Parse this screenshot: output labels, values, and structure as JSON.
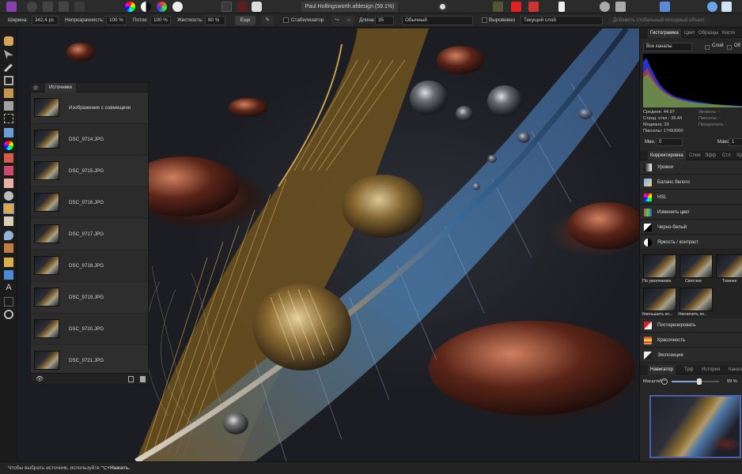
{
  "window": {
    "doc_title": "Paul Hollingsworth.afdesign (59.1%)"
  },
  "context_toolbar": {
    "width_label": "Ширина:",
    "width_value": "342,4 px",
    "opacity_label": "Непрозрачность:",
    "opacity_value": "100 %",
    "flow_label": "Поток:",
    "flow_value": "100 %",
    "hardness_label": "Жесткость:",
    "hardness_value": "80 %",
    "more_button": "Еще",
    "stabilizer_label": "Стабилизатор",
    "length_label": "Длина:",
    "length_value": "35",
    "mode_value": "Обычный",
    "aligned_label": "Выровнено",
    "source_value": "Текущий слой",
    "add_global_source": "Добавить глобальный исходный объект"
  },
  "sources_panel": {
    "tab": "Источники",
    "items": [
      "Изображение с совмещени",
      "DSC_9714.JPG",
      "DSC_9715.JPG",
      "DSC_9716.JPG",
      "DSC_9717.JPG",
      "DSC_9718.JPG",
      "DSC_9719.JPG",
      "DSC_9720.JPG",
      "DSC_9721.JPG"
    ]
  },
  "histogram_panel": {
    "tabs": [
      "Гистограмма",
      "Цвет",
      "Образцы",
      "Кисти"
    ],
    "channel_select": "Все каналы",
    "layer_label": "Слой",
    "ob_label": "Об",
    "stats_left": [
      "Среднее: 44.97",
      "Станд. откл.: 39.44",
      "Медиана: 33",
      "Пикселы: 17493000"
    ],
    "stats_right": [
      "Уровень: -",
      "Пикселы: -",
      "Процентиль: -"
    ],
    "min_label": "Мин.",
    "min_value": "0",
    "max_label": "Макс.",
    "max_value": "1"
  },
  "adjustments_panel": {
    "tabs": [
      "Корректировка",
      "Слои",
      "Эфф",
      "Стл",
      "Хр"
    ],
    "items": [
      "Уровни",
      "Баланс белого",
      "HSL",
      "Изменить цвет",
      "Черно-белый",
      "Яркость / контраст"
    ],
    "presets": [
      "По умолчанию",
      "Светлее",
      "Темнее",
      "Уменьшить ко...",
      "Увеличить ко..."
    ],
    "items_after": [
      "Постеризировать",
      "Красочность",
      "Экспозиция"
    ]
  },
  "navigator_panel": {
    "tabs": [
      "Навигатор",
      "Трф",
      "История",
      "Канал"
    ],
    "zoom_label": "Масштаб",
    "zoom_value": "59 %",
    "zoom_fraction": 0.59
  },
  "status_bar": {
    "text": "Чтобы выбрать источник, используйте",
    "shortcut": "⌥+Нажать."
  },
  "colors": {
    "accent_blue": "#4a5fa8",
    "persona_icon": "#8a3fb0"
  }
}
